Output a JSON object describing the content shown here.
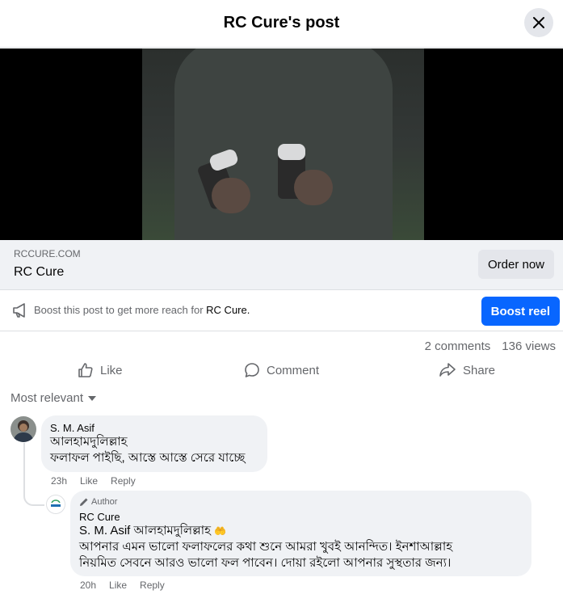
{
  "header": {
    "title": "RC Cure's post"
  },
  "link_preview": {
    "domain": "RCCURE.COM",
    "title": "RC Cure",
    "cta": "Order now"
  },
  "boost": {
    "text": "Boost this post to get more reach for ",
    "page": "RC Cure.",
    "button": "Boost reel"
  },
  "stats": {
    "comments": "2 comments",
    "views": "136 views"
  },
  "actions": {
    "like": "Like",
    "comment": "Comment",
    "share": "Share"
  },
  "sort": {
    "label": "Most relevant"
  },
  "comments": [
    {
      "author": "S. M. Asif",
      "line1": "আলহামদুলিল্লাহ",
      "line2": "ফলাফল পাইছি, আস্তে আস্তে সেরে যাচ্ছে",
      "time": "23h",
      "like": "Like",
      "reply": "Reply"
    },
    {
      "badge": "Author",
      "author": "RC Cure",
      "mention": "S. M. Asif",
      "line1": "আলহামদুলিল্লাহ",
      "emoji": "🤲",
      "line2": "আপনার এমন ভালো ফলাফলের কথা শুনে আমরা খুবই আনন্দিত। ইনশাআল্লাহ",
      "line3": "নিয়মিত সেবনে আরও ভালো ফল পাবেন। দোয়া রইলো আপনার সুস্থতার জন্য।",
      "time": "20h",
      "like": "Like",
      "reply": "Reply"
    }
  ]
}
